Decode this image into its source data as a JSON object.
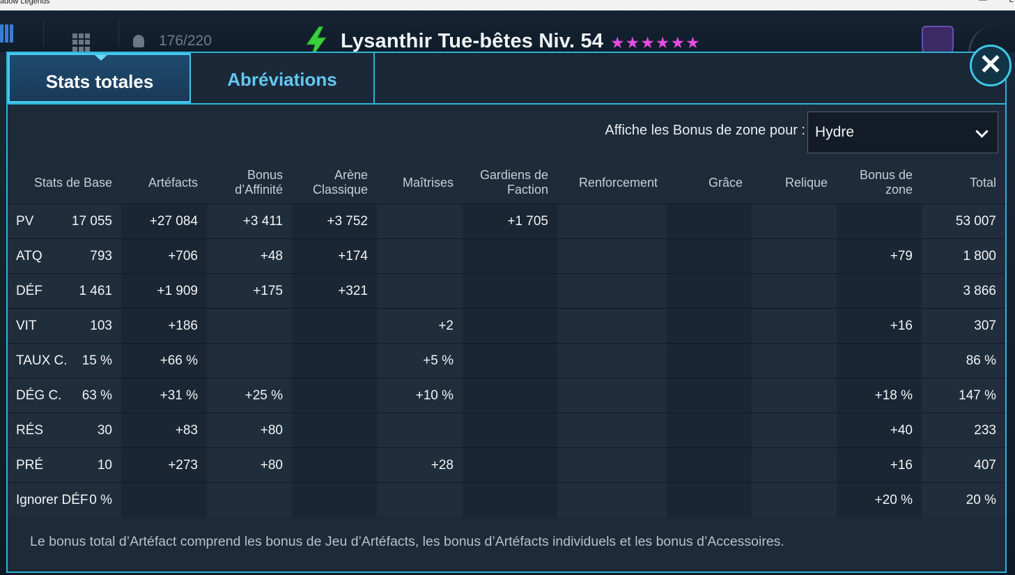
{
  "os": {
    "title": "adow Legends",
    "min": "—",
    "max": "L"
  },
  "topbar": {
    "count": "176/220",
    "hero_title": "Lysanthir Tue-bêtes Niv. 54",
    "stars": "★★★★★★"
  },
  "tabs": [
    {
      "label": "Stats totales"
    },
    {
      "label": "Abréviations"
    }
  ],
  "close": {
    "label": "✕"
  },
  "zone": {
    "label": "Affiche les Bonus de zone pour :",
    "selected": "Hydre"
  },
  "headers": [
    "Stats de Base",
    "Artéfacts",
    "Bonus\nd’Affinité",
    "Arène\nClassique",
    "Maîtrises",
    "Gardiens de\nFaction",
    "Renforcement",
    "Grâce",
    "Relique",
    "Bonus de\nzone",
    "Total"
  ],
  "rows": [
    {
      "name": "PV",
      "base": "17 055",
      "artefacts": "+27 084",
      "affinite": "+3 411",
      "arene": "+3 752",
      "maitrises": "",
      "gardiens": "+1 705",
      "renforcement": "",
      "grace": "",
      "relique": "",
      "zone": "",
      "total": "53 007"
    },
    {
      "name": "ATQ",
      "base": "793",
      "artefacts": "+706",
      "affinite": "+48",
      "arene": "+174",
      "maitrises": "",
      "gardiens": "",
      "renforcement": "",
      "grace": "",
      "relique": "",
      "zone": "+79",
      "total": "1 800"
    },
    {
      "name": "DÉF",
      "base": "1 461",
      "artefacts": "+1 909",
      "affinite": "+175",
      "arene": "+321",
      "maitrises": "",
      "gardiens": "",
      "renforcement": "",
      "grace": "",
      "relique": "",
      "zone": "",
      "total": "3 866"
    },
    {
      "name": "VIT",
      "base": "103",
      "artefacts": "+186",
      "affinite": "",
      "arene": "",
      "maitrises": "+2",
      "gardiens": "",
      "renforcement": "",
      "grace": "",
      "relique": "",
      "zone": "+16",
      "total": "307"
    },
    {
      "name": "TAUX C.",
      "base": "15 %",
      "artefacts": "+66 %",
      "affinite": "",
      "arene": "",
      "maitrises": "+5 %",
      "gardiens": "",
      "renforcement": "",
      "grace": "",
      "relique": "",
      "zone": "",
      "total": "86 %"
    },
    {
      "name": "DÉG C.",
      "base": "63 %",
      "artefacts": "+31 %",
      "affinite": "+25 %",
      "arene": "",
      "maitrises": "+10 %",
      "gardiens": "",
      "renforcement": "",
      "grace": "",
      "relique": "",
      "zone": "+18 %",
      "total": "147 %"
    },
    {
      "name": "RÉS",
      "base": "30",
      "artefacts": "+83",
      "affinite": "+80",
      "arene": "",
      "maitrises": "",
      "gardiens": "",
      "renforcement": "",
      "grace": "",
      "relique": "",
      "zone": "+40",
      "total": "233"
    },
    {
      "name": "PRÉ",
      "base": "10",
      "artefacts": "+273",
      "affinite": "+80",
      "arene": "",
      "maitrises": "+28",
      "gardiens": "",
      "renforcement": "",
      "grace": "",
      "relique": "",
      "zone": "+16",
      "total": "407"
    },
    {
      "name": "Ignorer DÉF",
      "base": "0 %",
      "artefacts": "",
      "affinite": "",
      "arene": "",
      "maitrises": "",
      "gardiens": "",
      "renforcement": "",
      "grace": "",
      "relique": "",
      "zone": "+20 %",
      "total": "20 %"
    }
  ],
  "footnote": "Le bonus total d’Artéfact comprend les bonus de Jeu d’Artéfacts, les bonus d’Artéfacts individuels et les bonus d’Accessoires.",
  "colors": {
    "accent": "#2fb3d6",
    "green": "#38d43c",
    "total": "#f3cb43",
    "stars": "#e74be0"
  }
}
